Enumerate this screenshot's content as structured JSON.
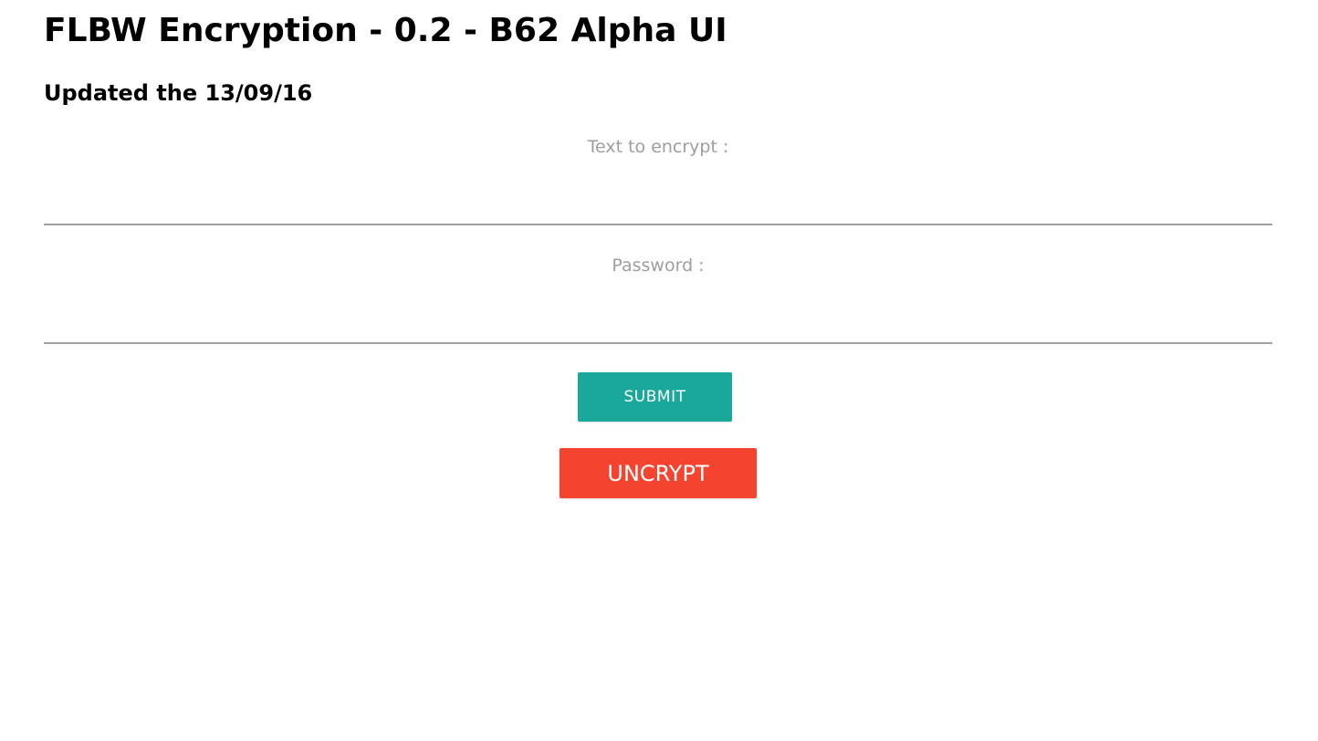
{
  "header": {
    "title": "FLBW Encryption - 0.2 - B62 Alpha UI",
    "subtitle": "Updated the 13/09/16"
  },
  "form": {
    "text_label": "Text to encrypt :",
    "text_value": "",
    "password_label": "Password :",
    "password_value": "",
    "submit_label": "SUBMIT",
    "uncrypt_label": "UNCRYPT"
  },
  "colors": {
    "submit_button": "#1aa89a",
    "uncrypt_button": "#f44430",
    "label_text": "#9e9e9e",
    "input_underline": "#a0a0a0"
  }
}
